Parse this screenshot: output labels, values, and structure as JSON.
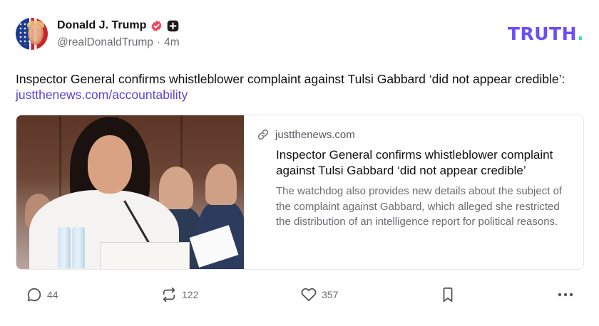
{
  "author": {
    "display_name": "Donald J. Trump",
    "handle": "@realDonaldTrump",
    "separator": "·",
    "time_ago": "4m"
  },
  "brand": {
    "logo_text": "TRUTH",
    "logo_dot": ".",
    "accent_color": "#6b4ef6",
    "dot_color": "#3fd9c0",
    "link_color": "#5a46d8"
  },
  "post": {
    "text": "Inspector General confirms whistleblower complaint against Tulsi Gabbard ‘did not appear credible’: ",
    "link_text": "justthenews.com/accountability"
  },
  "link_card": {
    "domain": "justthenews.com",
    "title": "Inspector General confirms whistleblower complaint against Tulsi Gabbard ‘did not appear credible’",
    "description": "The watchdog also provides new details about the subject of the complaint against Gabbard, which alleged she restricted the distribution of an intelligence report for political reasons."
  },
  "actions": {
    "reply_count": "44",
    "retruth_count": "122",
    "like_count": "357",
    "icons": [
      "reply-icon",
      "retruth-icon",
      "heart-icon",
      "bookmark-icon",
      "more-icon"
    ]
  }
}
